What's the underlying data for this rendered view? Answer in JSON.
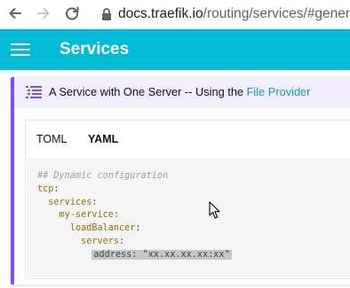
{
  "browser": {
    "url_host": "docs.traefik.io",
    "url_path": "/routing/services/#general"
  },
  "header": {
    "title": "Services",
    "accent_color": "#00bcd4"
  },
  "admonition": {
    "title_text": "A Service with One Server -- Using the ",
    "title_link": "File Provider",
    "accent_color": "#7c4dff",
    "icon": "list-icon"
  },
  "tabs": [
    {
      "label": "TOML",
      "active": false
    },
    {
      "label": "YAML",
      "active": true
    }
  ],
  "code": {
    "comment": "## Dynamic configuration",
    "lines": [
      {
        "indent": "",
        "key": "tcp"
      },
      {
        "indent": "  ",
        "key": "services"
      },
      {
        "indent": "    ",
        "key": "my-service"
      },
      {
        "indent": "      ",
        "key": "loadBalancer"
      },
      {
        "indent": "        ",
        "key": "servers"
      }
    ],
    "address_key": "address",
    "address_value": "\"xx.xx.xx.xx:xx\""
  }
}
